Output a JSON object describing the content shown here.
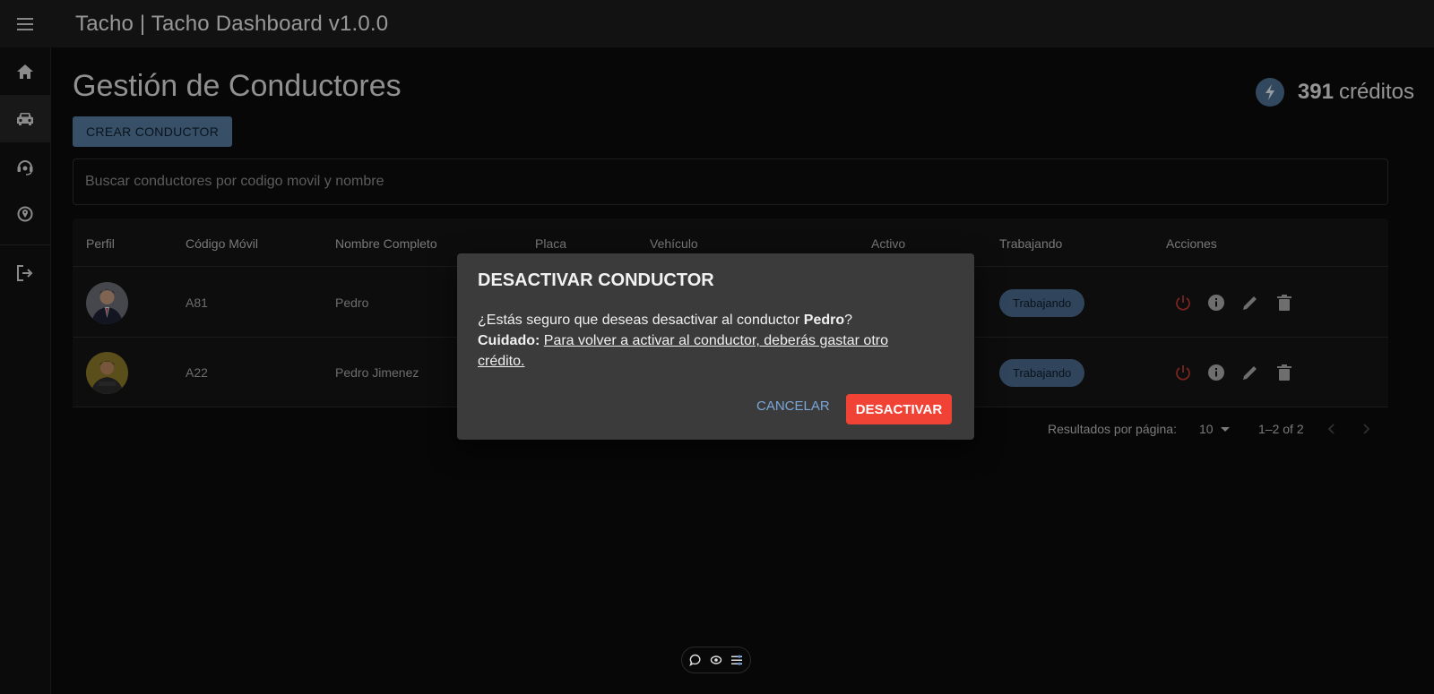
{
  "app": {
    "title": "Tacho | Tacho Dashboard v1.0.0"
  },
  "sidebar": {
    "items": [
      "home-icon",
      "car-icon",
      "support-agent-icon",
      "location-icon",
      "logout-icon"
    ]
  },
  "page": {
    "title": "Gestión de Conductores",
    "create_label": "CREAR CONDUCTOR"
  },
  "credits": {
    "value": "391",
    "label": "créditos"
  },
  "search": {
    "placeholder": "Buscar conductores por codigo movil y nombre"
  },
  "table": {
    "headers": [
      "Perfil",
      "Código Móvil",
      "Nombre Completo",
      "Placa",
      "Vehículo",
      "Activo",
      "Trabajando",
      "Acciones"
    ],
    "rows": [
      {
        "code": "A81",
        "name": "Pedro",
        "status": "Trabajando"
      },
      {
        "code": "A22",
        "name": "Pedro Jimenez",
        "status": "Trabajando"
      }
    ]
  },
  "pagination": {
    "label": "Resultados por página:",
    "per_page": "10",
    "range": "1–2 of 2"
  },
  "dialog": {
    "title": "DESACTIVAR CONDUCTOR",
    "question_prefix": "¿Estás seguro que deseas desactivar al conductor ",
    "driver_name": "Pedro",
    "question_suffix": "?",
    "warning_label": "Cuidado:",
    "warning_text": "Para volver a activar al conductor, deberás gastar otro crédito.",
    "cancel_label": "CANCELAR",
    "confirm_label": "DESACTIVAR"
  },
  "colors": {
    "accent": "#557a9e",
    "danger": "#f04235",
    "chip": "#4a6a8e",
    "dialog_bg": "#3b3b3b"
  }
}
